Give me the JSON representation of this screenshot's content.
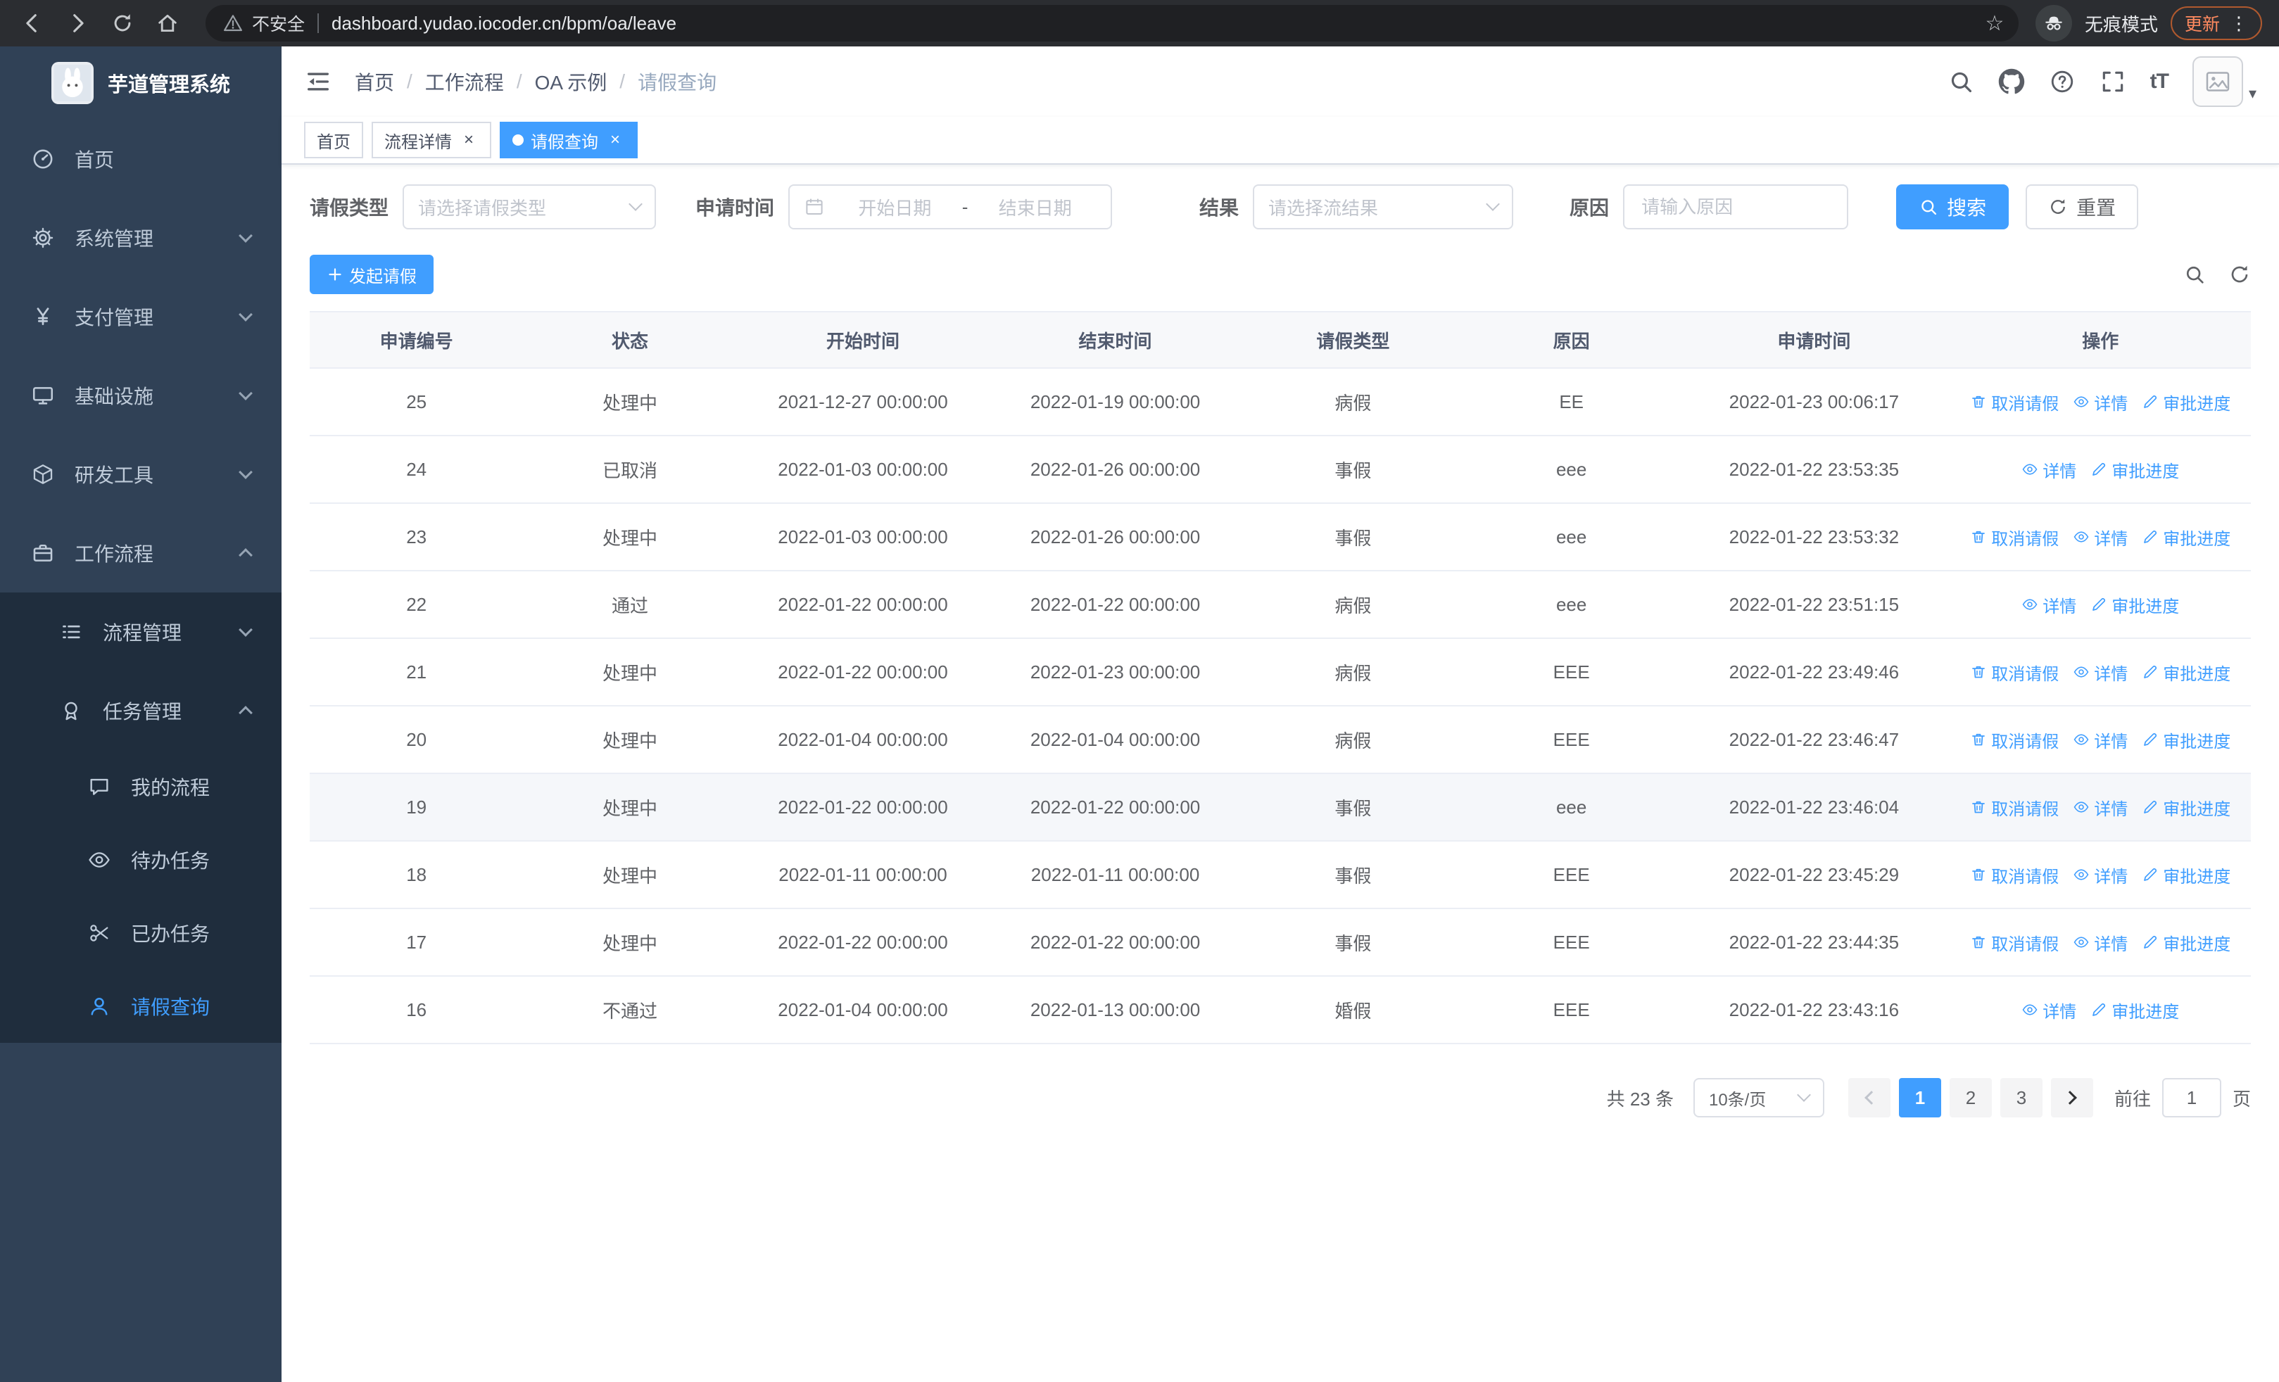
{
  "browser": {
    "security_label": "不安全",
    "url": "dashboard.yudao.iocoder.cn/bpm/oa/leave",
    "incognito_label": "无痕模式",
    "update_label": "更新"
  },
  "sidebar": {
    "logo_title": "芋道管理系统",
    "items": [
      {
        "id": "home",
        "label": "首页",
        "icon": "dashboard",
        "level": 1
      },
      {
        "id": "system",
        "label": "系统管理",
        "icon": "gear",
        "level": 1,
        "chevron": "down"
      },
      {
        "id": "payment",
        "label": "支付管理",
        "icon": "yen",
        "level": 1,
        "chevron": "down"
      },
      {
        "id": "infrastructure",
        "label": "基础设施",
        "icon": "monitor",
        "level": 1,
        "chevron": "down"
      },
      {
        "id": "dev-tools",
        "label": "研发工具",
        "icon": "box",
        "level": 1,
        "chevron": "down"
      },
      {
        "id": "workflow",
        "label": "工作流程",
        "icon": "suitcase",
        "level": 1,
        "chevron": "up",
        "children": [
          {
            "id": "process-mgmt",
            "label": "流程管理",
            "icon": "list",
            "level": 2,
            "chevron": "down"
          },
          {
            "id": "task-mgmt",
            "label": "任务管理",
            "icon": "medal",
            "level": 2,
            "chevron": "up",
            "children": [
              {
                "id": "my-process",
                "label": "我的流程",
                "icon": "chat",
                "level": 3
              },
              {
                "id": "todo-tasks",
                "label": "待办任务",
                "icon": "eye",
                "level": 3
              },
              {
                "id": "done-tasks",
                "label": "已办任务",
                "icon": "scissors",
                "level": 3
              },
              {
                "id": "leave-query",
                "label": "请假查询",
                "icon": "user",
                "level": 3,
                "active": true
              }
            ]
          }
        ]
      }
    ]
  },
  "header": {
    "breadcrumb": [
      "首页",
      "工作流程",
      "OA 示例",
      "请假查询"
    ],
    "separator": "/",
    "font_size_label": "tT"
  },
  "tabs": [
    {
      "id": "home",
      "label": "首页",
      "active": false,
      "closable": false
    },
    {
      "id": "process-detail",
      "label": "流程详情",
      "active": false,
      "closable": true
    },
    {
      "id": "leave-query",
      "label": "请假查询",
      "active": true,
      "closable": true
    }
  ],
  "filters": {
    "leave_type_label": "请假类型",
    "leave_type_placeholder": "请选择请假类型",
    "apply_time_label": "申请时间",
    "start_placeholder": "开始日期",
    "range_separator": "-",
    "end_placeholder": "结束日期",
    "result_label": "结果",
    "result_placeholder": "请选择流结果",
    "reason_label": "原因",
    "reason_placeholder": "请输入原因",
    "search_label": "搜索",
    "reset_label": "重置"
  },
  "toolbar": {
    "create_label": "发起请假"
  },
  "table": {
    "columns": [
      "申请编号",
      "状态",
      "开始时间",
      "结束时间",
      "请假类型",
      "原因",
      "申请时间",
      "操作"
    ],
    "actions": {
      "cancel": "取消请假",
      "detail": "详情",
      "progress": "审批进度"
    },
    "rows": [
      {
        "id": "25",
        "status": "处理中",
        "start": "2021-12-27 00:00:00",
        "end": "2022-01-19 00:00:00",
        "type": "病假",
        "reason": "EE",
        "applied": "2022-01-23 00:06:17",
        "cancelable": true,
        "highlight": false
      },
      {
        "id": "24",
        "status": "已取消",
        "start": "2022-01-03 00:00:00",
        "end": "2022-01-26 00:00:00",
        "type": "事假",
        "reason": "eee",
        "applied": "2022-01-22 23:53:35",
        "cancelable": false,
        "highlight": false
      },
      {
        "id": "23",
        "status": "处理中",
        "start": "2022-01-03 00:00:00",
        "end": "2022-01-26 00:00:00",
        "type": "事假",
        "reason": "eee",
        "applied": "2022-01-22 23:53:32",
        "cancelable": true,
        "highlight": false
      },
      {
        "id": "22",
        "status": "通过",
        "start": "2022-01-22 00:00:00",
        "end": "2022-01-22 00:00:00",
        "type": "病假",
        "reason": "eee",
        "applied": "2022-01-22 23:51:15",
        "cancelable": false,
        "highlight": false
      },
      {
        "id": "21",
        "status": "处理中",
        "start": "2022-01-22 00:00:00",
        "end": "2022-01-23 00:00:00",
        "type": "病假",
        "reason": "EEE",
        "applied": "2022-01-22 23:49:46",
        "cancelable": true,
        "highlight": false
      },
      {
        "id": "20",
        "status": "处理中",
        "start": "2022-01-04 00:00:00",
        "end": "2022-01-04 00:00:00",
        "type": "病假",
        "reason": "EEE",
        "applied": "2022-01-22 23:46:47",
        "cancelable": true,
        "highlight": false
      },
      {
        "id": "19",
        "status": "处理中",
        "start": "2022-01-22 00:00:00",
        "end": "2022-01-22 00:00:00",
        "type": "事假",
        "reason": "eee",
        "applied": "2022-01-22 23:46:04",
        "cancelable": true,
        "highlight": true
      },
      {
        "id": "18",
        "status": "处理中",
        "start": "2022-01-11 00:00:00",
        "end": "2022-01-11 00:00:00",
        "type": "事假",
        "reason": "EEE",
        "applied": "2022-01-22 23:45:29",
        "cancelable": true,
        "highlight": false
      },
      {
        "id": "17",
        "status": "处理中",
        "start": "2022-01-22 00:00:00",
        "end": "2022-01-22 00:00:00",
        "type": "事假",
        "reason": "EEE",
        "applied": "2022-01-22 23:44:35",
        "cancelable": true,
        "highlight": false
      },
      {
        "id": "16",
        "status": "不通过",
        "start": "2022-01-04 00:00:00",
        "end": "2022-01-13 00:00:00",
        "type": "婚假",
        "reason": "EEE",
        "applied": "2022-01-22 23:43:16",
        "cancelable": false,
        "highlight": false
      }
    ]
  },
  "pagination": {
    "total_label": "共 23 条",
    "page_size_label": "10条/页",
    "pages": [
      "1",
      "2",
      "3"
    ],
    "active_page": "1",
    "goto_prefix": "前往",
    "goto_value": "1",
    "goto_suffix": "页"
  },
  "colors": {
    "primary": "#409eff",
    "sidebar_bg": "#304156",
    "submenu_bg": "#1f2d3d"
  }
}
